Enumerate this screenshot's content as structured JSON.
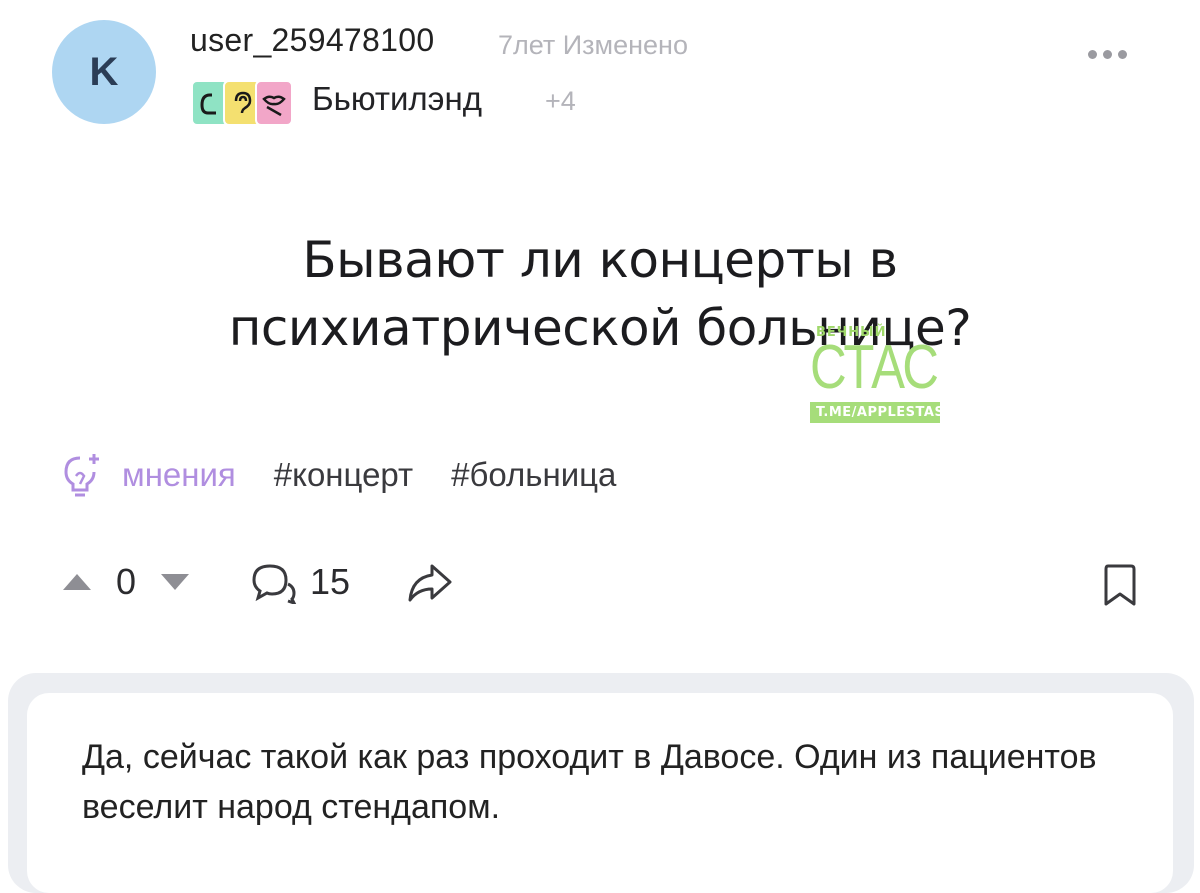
{
  "post": {
    "author": {
      "avatar_letter": "K",
      "username": "user_259478100",
      "age_label": "7лет Изменено"
    },
    "community": {
      "name": "Бьютилэнд",
      "more_count": "+4"
    },
    "title_line1": "Бывают ли концерты в",
    "title_line2": "психиатрической больнице?",
    "tags": {
      "primary": "мнения",
      "list": [
        "#концерт",
        "#больница"
      ]
    },
    "actions": {
      "score": "0",
      "comments": "15"
    }
  },
  "watermark": {
    "top": "ВЕЧНЫЙ",
    "main": "СТАС",
    "sub": "T.ME/APPLESTAS"
  },
  "comment": {
    "text": "Да, сейчас такой как раз проходит в Давосе. Один из пациентов веселит народ стендапом."
  },
  "colors": {
    "avatar_bg": "#aed6f2",
    "tag_primary": "#b08ee0",
    "watermark_green": "#a6dd7a",
    "comment_card_bg": "#eceef2",
    "muted_text": "#b4b4ba"
  },
  "icons": [
    "more-dots-icon",
    "upvote-icon",
    "downvote-icon",
    "comments-icon",
    "share-icon",
    "bookmark-icon",
    "lightbulb-icon"
  ]
}
